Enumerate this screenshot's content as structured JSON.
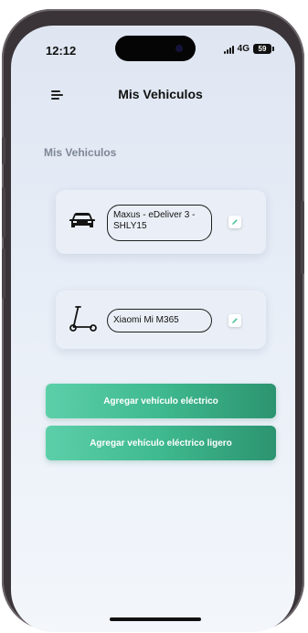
{
  "status_bar": {
    "time": "12:12",
    "network": "4G",
    "battery": "59"
  },
  "header": {
    "title": "Mis Vehiculos",
    "menu_icon": "hamburger-menu-icon"
  },
  "section": {
    "title": "Mis Vehiculos"
  },
  "vehicles": [
    {
      "icon": "car-icon",
      "name": "Maxus - eDeliver 3 - SHLY15",
      "edit_icon": "pencil-icon"
    },
    {
      "icon": "scooter-icon",
      "name": "Xiaomi Mi M365",
      "edit_icon": "pencil-icon"
    }
  ],
  "actions": {
    "add_electric_vehicle": "Agregar vehículo eléctrico",
    "add_light_electric_vehicle": "Agregar vehículo eléctrico ligero"
  },
  "colors": {
    "accent_gradient_start": "#5ccfa9",
    "accent_gradient_end": "#2c9470",
    "background": "#e8eef7"
  }
}
